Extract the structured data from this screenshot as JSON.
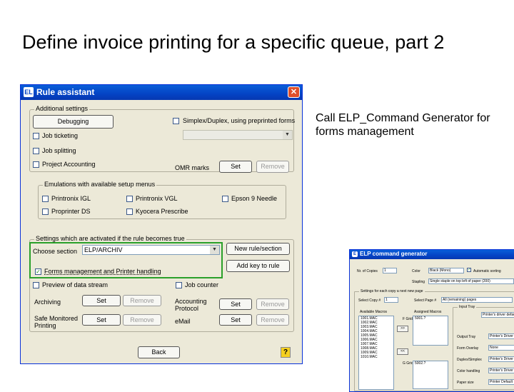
{
  "slide": {
    "title": "Define invoice printing for a specific queue, part 2",
    "callout": "Call ELP_Command Generator for forms management"
  },
  "rule_assistant": {
    "title": "Rule assistant",
    "close_label": "✕",
    "additional_settings": {
      "label": "Additional settings",
      "debugging_button": "Debugging",
      "simplex_label": "Simplex/Duplex, using preprinted forms",
      "job_ticketing": "Job ticketing",
      "job_splitting": "Job splitting",
      "project_accounting": "Project Accounting",
      "omr_label": "OMR marks",
      "omr_set": "Set",
      "omr_remove": "Remove"
    },
    "emulations": {
      "label": "Emulations with available setup menus",
      "items": [
        "Printronix IGL",
        "Printronix VGL",
        "Epson 9 Needle",
        "Proprinter DS",
        "Kyocera Prescribe"
      ]
    },
    "settings_active": {
      "label": "Settings which are activated if the rule becomes true",
      "choose_section_label": "Choose section",
      "choose_section_value": "ELP/ARCHIV",
      "new_rule_section_button": "New rule/section",
      "add_key_button": "Add key to rule",
      "forms_management_label": "Forms management and Printer handling",
      "preview_label": "Preview of data stream",
      "job_counter_label": "Job counter",
      "archiving_label": "Archiving",
      "archiving_set": "Set",
      "archiving_remove": "Remove",
      "accounting_label": "Accounting Protocol",
      "accounting_set": "Set",
      "accounting_remove": "Remove",
      "safe_printing_label": "Safe Monitored Printing",
      "safe_set": "Set",
      "safe_remove": "Remove",
      "email_label": "eMail",
      "email_set": "Set",
      "email_remove": "Remove"
    },
    "back_button": "Back",
    "help_label": "?"
  },
  "elp_generator": {
    "title": "ELP command generator",
    "nr_copies_label": "Nr. of Copies",
    "nr_copies_value": "1",
    "color_label": "Color",
    "color_value": "Black (Mono)",
    "auto_sorting_label": "Automatic sorting",
    "stapling_label": "Stapling",
    "stapling_value": "Single staple on top left of paper (200)",
    "settings_group_label": "Settings for each copy a next new page",
    "select_copy_label": "Select Copy #",
    "select_copy_value": "1",
    "select_page_label": "Select Page #",
    "select_page_value": "All (remaining) pages",
    "input_tray_label": "Input Tray",
    "input_tray_value": "Printer's driver default",
    "available_header": "Available Macros",
    "assigned_header": "Assigned Macros",
    "macros": [
      "1001.MAC",
      "1002.MAC",
      "1003.MAC",
      "1004.MAC",
      "1005.MAC",
      "1006.MAC",
      "1007.MAC",
      "1008.MAC",
      "1009.MAC",
      "1010.MAC"
    ],
    "assigned_group1_label": "F Grid",
    "assigned_group1_value": "5001.?",
    "assigned_group2_label": "G Grid",
    "assigned_group2_value": "5002.?",
    "output_tray_label": "Output Tray",
    "output_tray_value": "Printer's Driver D",
    "form_overlay_label": "Form Overlay",
    "form_overlay_value": "None",
    "duplex_label": "Duplex/Simplex",
    "duplex_value": "Printer's Driver D",
    "color_handling_label": "Color handling",
    "color_handling_value": "Printer's Driver D",
    "paper_size_label": "Paper size",
    "paper_size_value": "Printer Default",
    "move_right_button": ">>",
    "move_left_button": "<<"
  }
}
